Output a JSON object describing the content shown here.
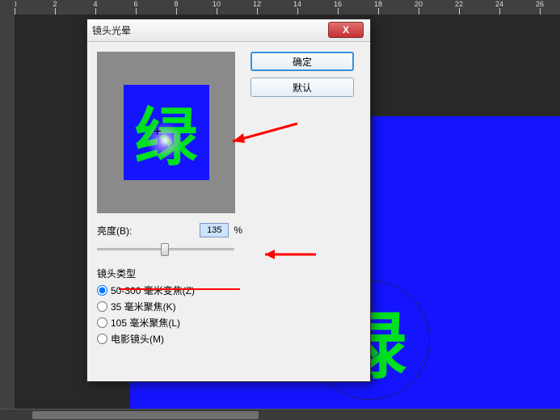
{
  "ruler": {
    "ticks": [
      0,
      2,
      4,
      6,
      8,
      10,
      12,
      14,
      16,
      18,
      20,
      22,
      24,
      26
    ]
  },
  "doc": {
    "glyph": "绿"
  },
  "dialog": {
    "title": "镜头光晕",
    "close": "X",
    "ok": "确定",
    "defaults": "默认",
    "brightness_label": "亮度(B):",
    "brightness_value": "135",
    "percent": "%",
    "lens_type_label": "镜头类型",
    "lens_options": [
      {
        "label": "50-300 毫米变焦(Z)",
        "checked": true
      },
      {
        "label": "35 毫米聚焦(K)",
        "checked": false
      },
      {
        "label": "105 毫米聚焦(L)",
        "checked": false
      },
      {
        "label": "电影镜头(M)",
        "checked": false
      }
    ],
    "preview_glyph": "绿"
  }
}
